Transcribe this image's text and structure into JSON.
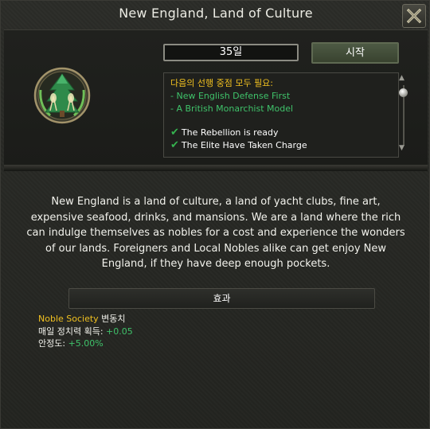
{
  "window": {
    "title": "New England, Land of Culture"
  },
  "header": {
    "days_label": "35일",
    "start_label": "시작"
  },
  "prerequisites": {
    "heading": "다음의 선행 중점 모두 필요:",
    "required_focuses": [
      "- New English Defense First",
      "- A British Monarchist Model"
    ],
    "completed": [
      "The Rebellion is ready",
      "The Elite Have Taken Charge"
    ]
  },
  "description": "New England is a land of culture, a land of yacht clubs, fine art, expensive seafood, drinks, and mansions. We are a land where the rich can indulge themselves as nobles for a cost and experience the wonders of our lands. Foreigners and Local Nobles alike can get enjoy New England, if they have deep enough pockets.",
  "effects_button": "효과",
  "effects": {
    "line1_key": "Noble Society",
    "line1_rest": " 변동치",
    "line2_label": "매일 정치력 획득: ",
    "line2_value": "+0.05",
    "line3_label": "안정도: ",
    "line3_value": "+5.00%"
  },
  "icons": {
    "close": "close-x-icon",
    "emblem": "pine-tree-champagne-emblem",
    "check": "checkmark-icon"
  },
  "colors": {
    "highlight_yellow": "#f0c020",
    "positive_green": "#3fc26a",
    "accent_button": "#4d5a44"
  }
}
